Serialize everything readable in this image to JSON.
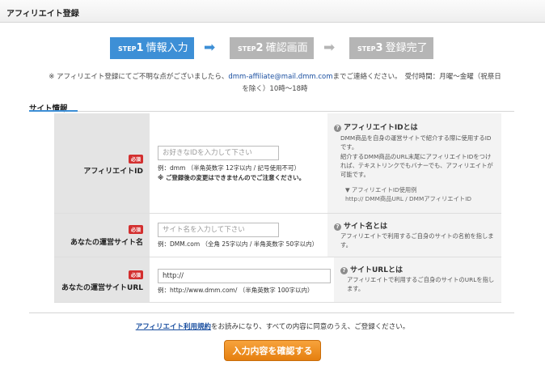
{
  "header": {
    "title": "アフィリエイト登録"
  },
  "steps": [
    {
      "prefix": "STEP",
      "num": "1",
      "label": "情報入力",
      "state": "active"
    },
    {
      "prefix": "STEP",
      "num": "2",
      "label": "確認画面",
      "state": "inactive"
    },
    {
      "prefix": "STEP",
      "num": "3",
      "label": "登録完了",
      "state": "inactive"
    }
  ],
  "notice": {
    "pre": "※ アフィリエイト登録にてご不明な点がございましたら、",
    "mail": "dmm-affiliate@mail.dmm.com",
    "post": "までご連絡ください。　受付時間：月曜～金曜（祝祭日を除く）10時～18時"
  },
  "section": {
    "title": "サイト情報"
  },
  "required_label": "必須",
  "fields": {
    "affiliate_id": {
      "label": "アフィリエイトID",
      "placeholder": "お好きなIDを入力して下さい",
      "value": "",
      "example": "例：dmm （半角英数字 12字以内 / 記号使用不可）",
      "warning": "※ ご登録後の変更はできませんのでご注意ください。",
      "info_title": "アフィリエイトIDとは",
      "info_body1": "DMM商品を自身の運営サイトで紹介する際に使用するIDです。",
      "info_body2": "紹介するDMM商品のURL末尾にアフィリエイトIDをつければ、テキストリンクでもバナーでも、アフィリエイトが可能です。",
      "info_ex_title": "▼ アフィリエイトID使用例",
      "info_ex_body": "http:// DMM商品URL / DMMアフィリエイトID"
    },
    "site_name": {
      "label": "あなたの運営サイト名",
      "placeholder": "サイト名を入力して下さい",
      "value": "",
      "example": "例：DMM.com （全角 25字以内 / 半角英数字 50字以内）",
      "info_title": "サイト名とは",
      "info_body": "アフィリエイトで利用するご自身のサイトの名前を指します。"
    },
    "site_url": {
      "label": "あなたの運営サイトURL",
      "placeholder": "",
      "value": "http://",
      "example": "例：http://www.dmm.com/ （半角英数字 100字以内）",
      "info_title": "サイトURLとは",
      "info_body": "アフィリエイトで利用するご自身のサイトのURLを指します。"
    }
  },
  "agreement": {
    "link": "アフィリエイト利用規約",
    "text": "をお読みになり、すべての内容に同意のうえ、ご登録ください。"
  },
  "submit_label": "入力内容を確認する",
  "colors": {
    "accent": "#3d8fd6",
    "required": "#d32f2f",
    "submit": "#f0921f"
  }
}
